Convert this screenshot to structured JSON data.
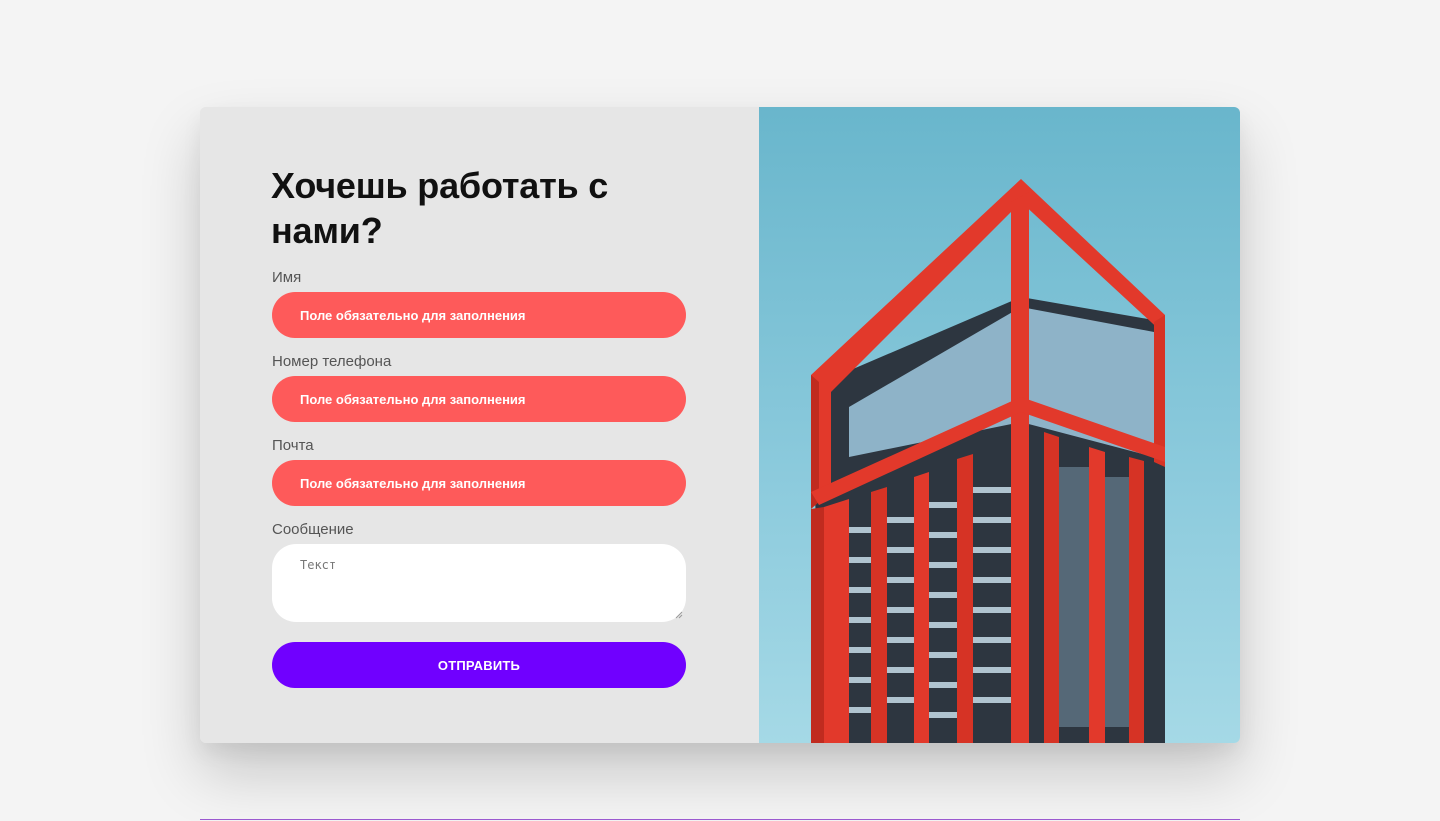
{
  "form": {
    "title": "Хочешь работать с нами?",
    "fields": [
      {
        "label": "Имя",
        "error_text": "Поле обязательно для заполнения"
      },
      {
        "label": "Номер телефона",
        "error_text": "Поле обязательно для заполнения"
      },
      {
        "label": "Почта",
        "error_text": "Поле обязательно для заполнения"
      }
    ],
    "message": {
      "label": "Сообщение",
      "placeholder": "Текст"
    },
    "submit_label": "ОТПРАВИТЬ"
  },
  "colors": {
    "error_field": "#fe5a5a",
    "submit_button": "#7000ff",
    "panel_background": "#e6e6e6",
    "sky": "#69b6cc",
    "building": "#e2392b"
  },
  "image": {
    "subject": "red-high-rise-building"
  }
}
